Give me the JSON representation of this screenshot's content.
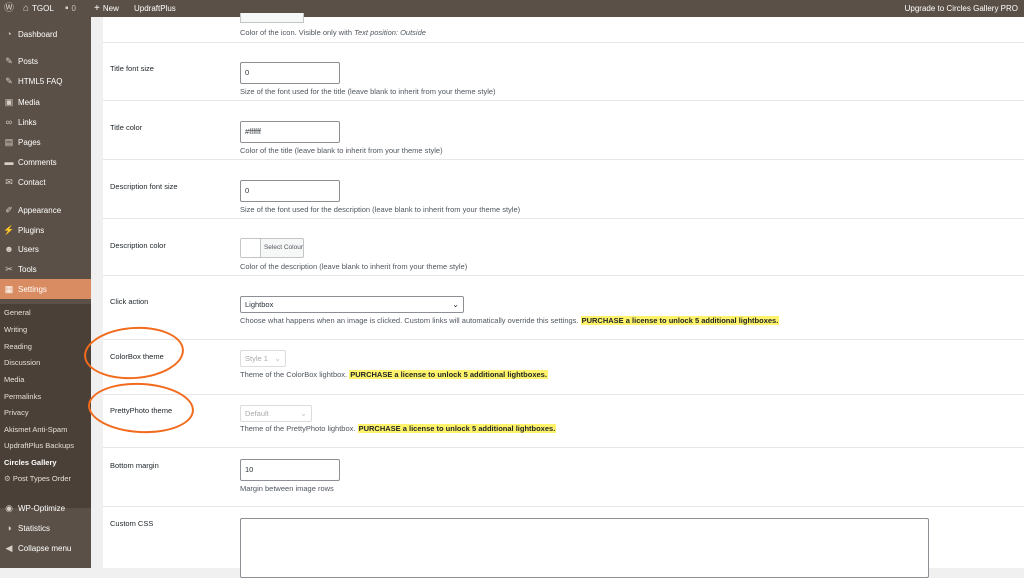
{
  "adminbar": {
    "site_name": "TGOL",
    "comments_count": "0",
    "new_label": "New",
    "updraft_label": "UpdraftPlus",
    "upgrade_label": "Upgrade to Circles Gallery PRO"
  },
  "sidebar": {
    "dashboard": "Dashboard",
    "posts": "Posts",
    "html5faq": "HTML5 FAQ",
    "media": "Media",
    "links": "Links",
    "pages": "Pages",
    "comments": "Comments",
    "contact": "Contact",
    "appearance": "Appearance",
    "plugins": "Plugins",
    "users": "Users",
    "tools": "Tools",
    "settings": "Settings",
    "submenu": [
      "General",
      "Writing",
      "Reading",
      "Discussion",
      "Media",
      "Permalinks",
      "Privacy",
      "Akismet Anti-Spam",
      "UpdraftPlus Backups",
      "Circles Gallery",
      "Post Types Order"
    ],
    "wpoptimize": "WP-Optimize",
    "statistics": "Statistics",
    "collapse": "Collapse menu"
  },
  "settings": {
    "icon_color_desc_prefix": "Color of the icon. Visible only with ",
    "icon_color_desc_em": "Text position: Outside",
    "title_font_size": {
      "label": "Title font size",
      "value": "0",
      "desc": "Size of the font used for the title (leave blank to inherit from your theme style)"
    },
    "title_color": {
      "label": "Title color",
      "value": "#ffffff",
      "desc": "Color of the title (leave blank to inherit from your theme style)"
    },
    "description_font_size": {
      "label": "Description font size",
      "value": "0",
      "desc": "Size of the font used for the description (leave blank to inherit from your theme style)"
    },
    "description_color": {
      "label": "Description color",
      "button": "Select Colour",
      "desc": "Color of the description (leave blank to inherit from your theme style)"
    },
    "click_action": {
      "label": "Click action",
      "value": "Lightbox",
      "desc": "Choose what happens when an image is clicked. Custom links will automatically override this settings.",
      "promo": "PURCHASE a license to unlock 5 additional lightboxes."
    },
    "colorbox_theme": {
      "label": "ColorBox theme",
      "value": "Style 1",
      "desc": "Theme of the ColorBox lightbox.",
      "promo": "PURCHASE a license to unlock 5 additional lightboxes."
    },
    "prettyphoto_theme": {
      "label": "PrettyPhoto theme",
      "value": "Default",
      "desc": "Theme of the PrettyPhoto lightbox.",
      "promo": "PURCHASE a license to unlock 5 additional lightboxes."
    },
    "bottom_margin": {
      "label": "Bottom margin",
      "value": "10",
      "desc": "Margin between image rows"
    },
    "custom_css": {
      "label": "Custom CSS"
    }
  },
  "colors": {
    "adminbar_bg": "#5b5047",
    "sidebar_bg": "#5b5047",
    "active_menu": "#d98c61",
    "highlight": "#fff36b",
    "annotation": "#f26b1d"
  }
}
